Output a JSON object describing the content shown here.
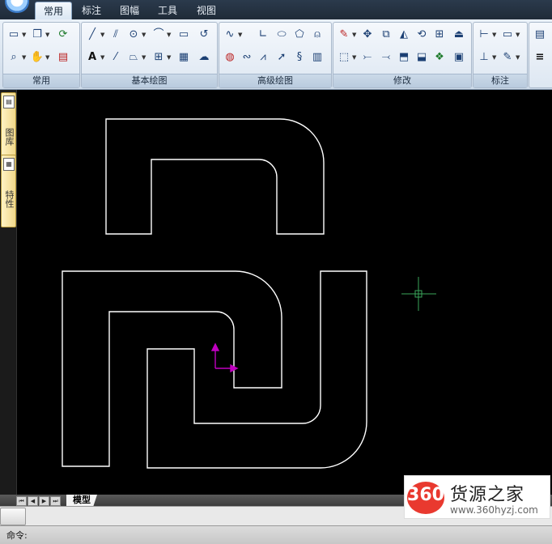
{
  "tabs": [
    {
      "label": "常用",
      "active": true
    },
    {
      "label": "标注",
      "active": false
    },
    {
      "label": "图幅",
      "active": false
    },
    {
      "label": "工具",
      "active": false
    },
    {
      "label": "视图",
      "active": false
    }
  ],
  "ribbon": {
    "groups": [
      "常用",
      "基本绘图",
      "高级绘图",
      "修改",
      "标注"
    ]
  },
  "left_palette": {
    "tabs": [
      "图库",
      "特性"
    ]
  },
  "layout_bar": {
    "model_tab": "模型"
  },
  "command": {
    "prompt": "命令:"
  },
  "watermark": {
    "badge": "360",
    "title": "货源之家",
    "url": "www.360hyzj.com"
  },
  "colors": {
    "canvas": "#000000",
    "geometry": "#ffffff",
    "ucs": "#c000c0",
    "crosshair": "#3aa65a"
  },
  "icons": {
    "ribbon_tools": [
      "new-icon",
      "open-icon",
      "refresh-icon",
      "zoom-icon",
      "pan-icon",
      "layer-icon",
      "line-icon",
      "parallel-icon",
      "circle-icon",
      "arc-icon",
      "rectangle-icon",
      "polyline-icon",
      "text-icon",
      "xline-icon",
      "region-icon",
      "insert-icon",
      "hatch-icon",
      "cloud-icon",
      "spline-icon",
      "angle-icon",
      "ellipse-icon",
      "polygon-icon",
      "revcloud-icon",
      "wave-icon",
      "zigzag-icon",
      "arrow-icon",
      "curve-icon",
      "fill-icon",
      "erase-icon",
      "move-icon",
      "copy-icon",
      "mirror-icon",
      "rotate-icon",
      "array-icon",
      "stretch-icon",
      "trim-icon",
      "extend-icon",
      "fillet-icon",
      "scale-icon",
      "offset-icon",
      "dim-linear-icon",
      "dim-block-icon",
      "dim-more-icon"
    ]
  }
}
